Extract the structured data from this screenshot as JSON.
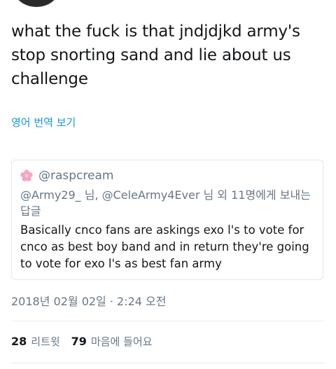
{
  "tweet": {
    "text": "what the fuck is that jndjdjkd army's stop snorting sand and lie about us challenge",
    "translate_label": "영어 번역 보기",
    "timestamp": "2018년 02월 02일 · 2:24 오전"
  },
  "quote": {
    "handle": "@raspcream",
    "reply_context": "@Army29_ 님, @CeleArmy4Ever 님 외 11명에게 보내는 답글",
    "text": "Basically cnco fans are askings exo l's to vote for cnco as best boy band and in return they're going to vote for exo l's as best fan army"
  },
  "stats": {
    "retweets_count": "28",
    "retweets_label": "리트윗",
    "likes_count": "79",
    "likes_label": "마음에 들어요"
  },
  "icons": {
    "quote_avatar": "cherry-blossom-icon"
  },
  "colors": {
    "text": "#14171a",
    "secondary": "#657786",
    "link": "#1b95e0",
    "border": "#e1e8ed"
  }
}
